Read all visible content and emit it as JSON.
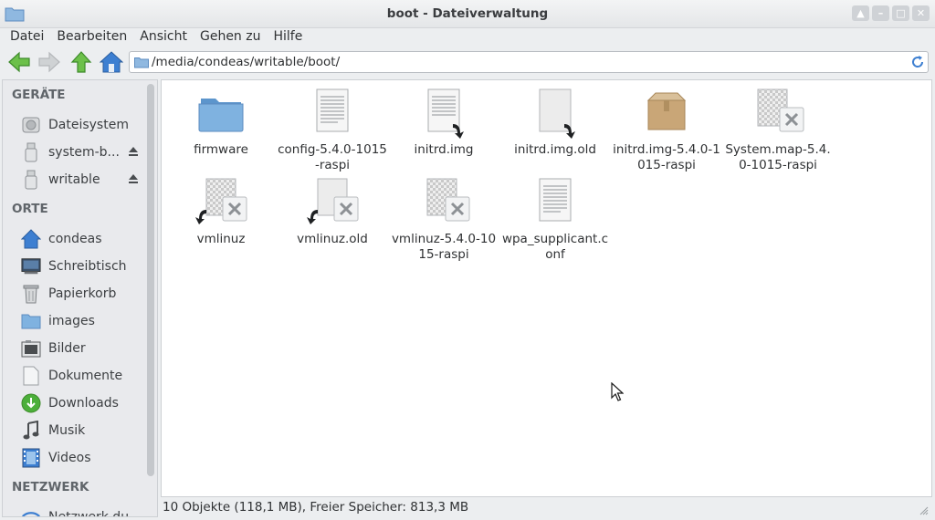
{
  "window": {
    "title": "boot - Dateiverwaltung"
  },
  "menubar": [
    "Datei",
    "Bearbeiten",
    "Ansicht",
    "Gehen zu",
    "Hilfe"
  ],
  "location": {
    "path": "/media/condeas/writable/boot/"
  },
  "sidebar": {
    "sections": {
      "devices": "GERÄTE",
      "places": "ORTE",
      "network": "NETZWERK"
    },
    "devices": [
      {
        "label": "Dateisystem",
        "icon": "harddisk-icon"
      },
      {
        "label": "system-b...",
        "icon": "usb-drive-icon",
        "eject": true
      },
      {
        "label": "writable",
        "icon": "usb-drive-icon",
        "eject": true
      }
    ],
    "places": [
      {
        "label": "condeas",
        "icon": "home-icon"
      },
      {
        "label": "Schreibtisch",
        "icon": "desktop-icon"
      },
      {
        "label": "Papierkorb",
        "icon": "trash-icon"
      },
      {
        "label": "images",
        "icon": "folder-icon"
      },
      {
        "label": "Bilder",
        "icon": "pictures-icon"
      },
      {
        "label": "Dokumente",
        "icon": "document-icon"
      },
      {
        "label": "Downloads",
        "icon": "download-icon"
      },
      {
        "label": "Musik",
        "icon": "music-icon"
      },
      {
        "label": "Videos",
        "icon": "video-icon"
      }
    ],
    "network": [
      {
        "label": "Netzwerk du...",
        "icon": "network-icon"
      }
    ]
  },
  "files": [
    {
      "name": "firmware",
      "icon": "folder-icon"
    },
    {
      "name": "config-5.4.0-1015-raspi",
      "icon": "text-file-icon"
    },
    {
      "name": "initrd.img",
      "icon": "text-file-link-icon"
    },
    {
      "name": "initrd.img.old",
      "icon": "blank-file-link-icon"
    },
    {
      "name": "initrd.img-5.4.0-1015-raspi",
      "icon": "package-icon"
    },
    {
      "name": "System.map-5.4.0-1015-raspi",
      "icon": "unknown-file-icon"
    },
    {
      "name": "vmlinuz",
      "icon": "unknown-file-link-icon"
    },
    {
      "name": "vmlinuz.old",
      "icon": "blank-unknown-link-icon"
    },
    {
      "name": "vmlinuz-5.4.0-1015-raspi",
      "icon": "unknown-file-icon"
    },
    {
      "name": "wpa_supplicant.conf",
      "icon": "text-file-icon"
    }
  ],
  "status": {
    "text": "10 Objekte (118,1 MB), Freier Speicher: 813,3 MB"
  },
  "colors": {
    "folder": "#6aa6da",
    "accent_green": "#4caf3a",
    "home_blue": "#3d7fd1"
  }
}
